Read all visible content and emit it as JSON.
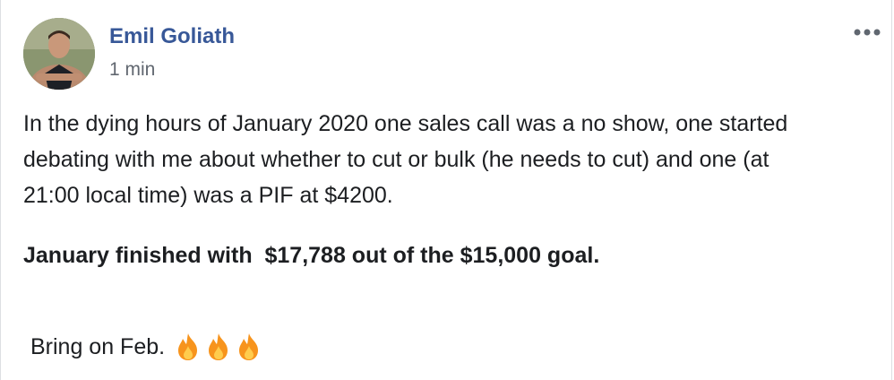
{
  "post": {
    "author": "Emil Goliath",
    "timestamp": "1 min",
    "more_icon": "ellipsis-horizontal-icon",
    "body_lines": [
      "In the dying hours of January 2020 one sales call was a no show, one started",
      "debating with me about whether to cut or bulk (he needs to cut) and one (at",
      "21:00 local time) was a PIF at $4200."
    ],
    "bold_line": "January finished with  $17,788 out of the $15,000 goal.",
    "closing_text": "Bring on Feb.",
    "emoji_icons": [
      "fire-icon",
      "fire-icon",
      "fire-icon"
    ]
  },
  "colors": {
    "author_link": "#385898",
    "text": "#1c1e21",
    "meta": "#616770",
    "fire_outer": "#f7941d",
    "fire_inner": "#ffcc4d"
  }
}
